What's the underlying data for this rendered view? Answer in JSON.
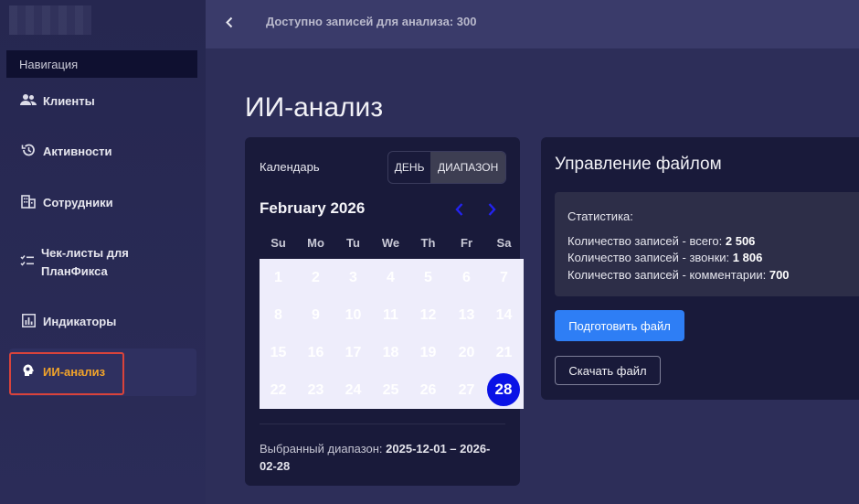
{
  "sidebar": {
    "nav_header": "Навигация",
    "items": [
      {
        "label": "Клиенты",
        "icon": "users-icon"
      },
      {
        "label": "Активности",
        "icon": "history-icon"
      },
      {
        "label": "Сотрудники",
        "icon": "building-icon"
      },
      {
        "label": "Чек-листы для ПланФикса",
        "icon": "checklist-icon"
      },
      {
        "label": "Индикаторы",
        "icon": "bar-chart-icon"
      },
      {
        "label": "ИИ-анализ",
        "icon": "brain-icon",
        "active": true
      }
    ]
  },
  "topbar": {
    "available_records": "Доступно записей для анализа: 300"
  },
  "page": {
    "title": "ИИ-анализ"
  },
  "calendar": {
    "label": "Календарь",
    "toggle_day": "ДЕНЬ",
    "toggle_range": "ДИАПАЗОН",
    "month": "February 2026",
    "weekdays": [
      "Su",
      "Mo",
      "Tu",
      "We",
      "Th",
      "Fr",
      "Sa"
    ],
    "days": [
      "1",
      "2",
      "3",
      "4",
      "5",
      "6",
      "7",
      "8",
      "9",
      "10",
      "11",
      "12",
      "13",
      "14",
      "15",
      "16",
      "17",
      "18",
      "19",
      "20",
      "21",
      "22",
      "23",
      "24",
      "25",
      "26",
      "27",
      "28"
    ],
    "selected_day": "28",
    "range_label": "Выбранный диапазон:",
    "range_value": "2025-12-01 – 2026-02-28"
  },
  "file": {
    "title": "Управление файлом",
    "stats_heading": "Статистика:",
    "stats": [
      {
        "label": "Количество записей - всего:",
        "value": "2 506"
      },
      {
        "label": "Количество записей - звонки:",
        "value": "1 806"
      },
      {
        "label": "Количество записей - комментарии:",
        "value": "700"
      }
    ],
    "prepare_button": "Подготовить файл",
    "download_button": "Скачать файл"
  },
  "colors": {
    "accent_blue": "#2e7ef5",
    "active_nav": "#f2a42a",
    "selected_day": "#0a12e6"
  }
}
